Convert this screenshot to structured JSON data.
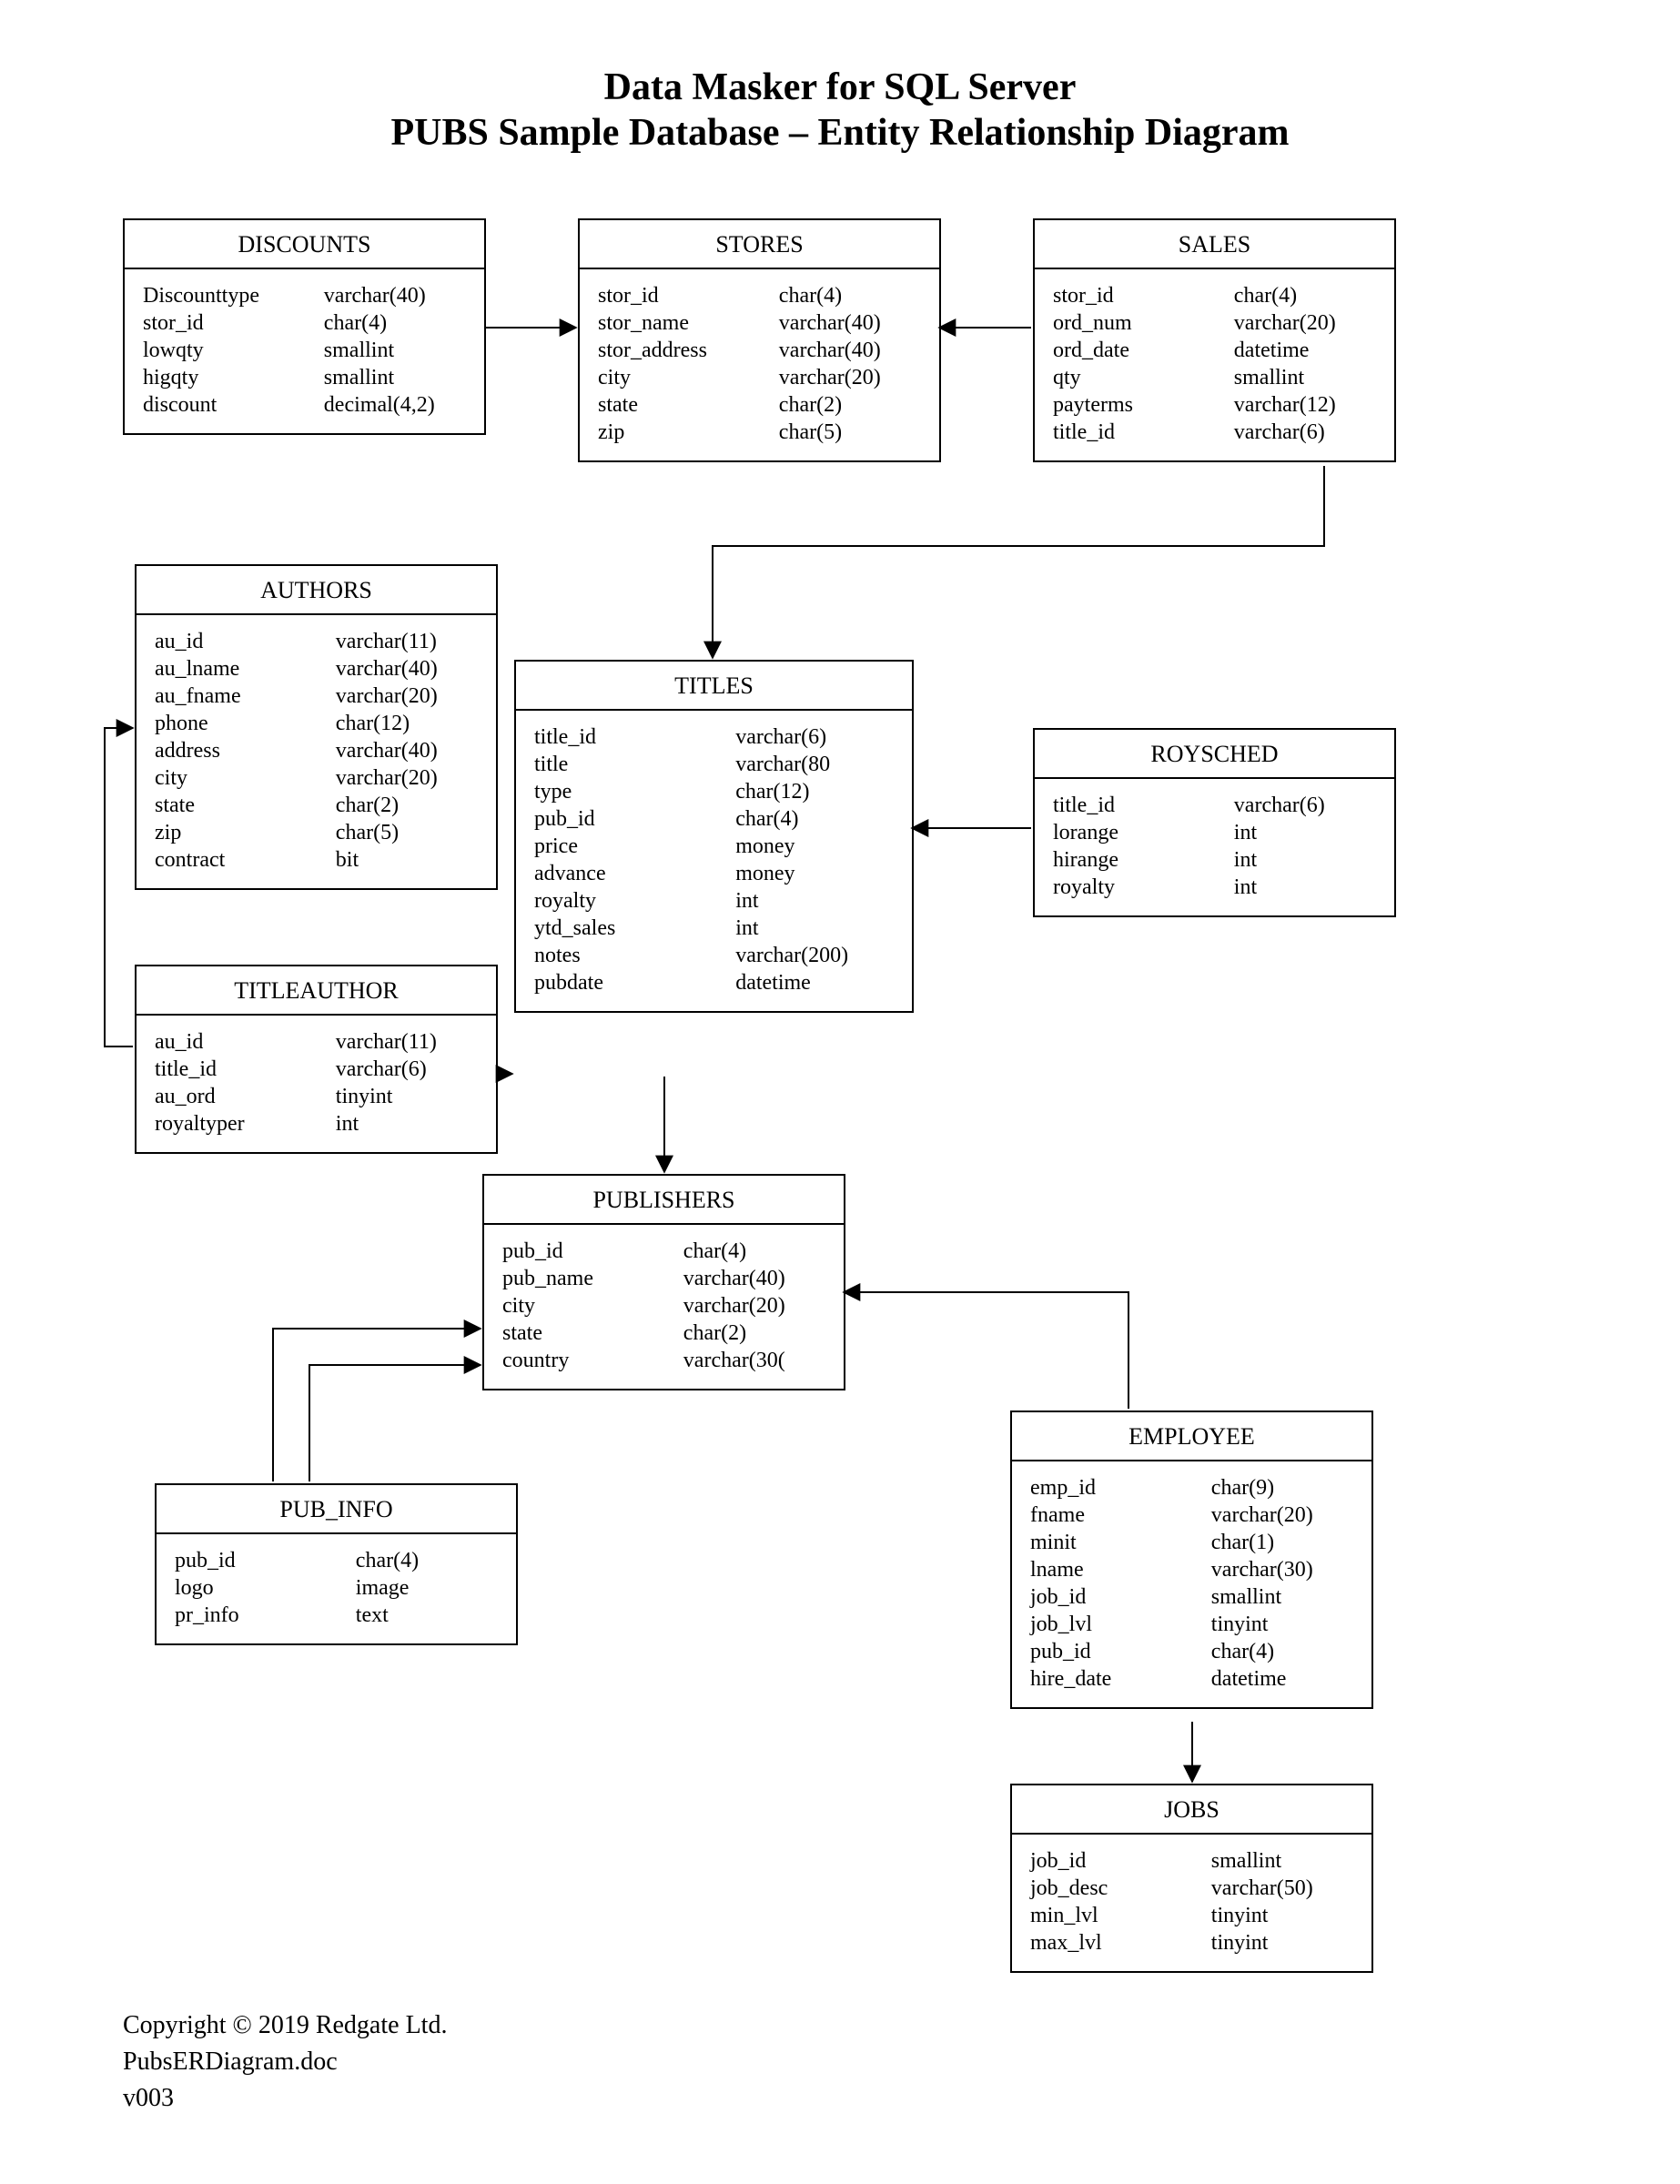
{
  "title_line1": "Data Masker for SQL Server",
  "title_line2": "PUBS Sample Database  – Entity Relationship Diagram",
  "footer": {
    "copyright": "Copyright © 2019 Redgate Ltd.",
    "filename": "PubsERDiagram.doc",
    "version": "v003"
  },
  "entities": {
    "discounts": {
      "name": "DISCOUNTS",
      "columns": [
        [
          "Discounttype",
          "varchar(40)"
        ],
        [
          "stor_id",
          "char(4)"
        ],
        [
          "lowqty",
          "smallint"
        ],
        [
          "higqty",
          "smallint"
        ],
        [
          "discount",
          "decimal(4,2)"
        ]
      ]
    },
    "stores": {
      "name": "STORES",
      "columns": [
        [
          "stor_id",
          "char(4)"
        ],
        [
          "stor_name",
          "varchar(40)"
        ],
        [
          "stor_address",
          "varchar(40)"
        ],
        [
          "city",
          "varchar(20)"
        ],
        [
          "state",
          "char(2)"
        ],
        [
          "zip",
          "char(5)"
        ]
      ]
    },
    "sales": {
      "name": "SALES",
      "columns": [
        [
          "stor_id",
          "char(4)"
        ],
        [
          "ord_num",
          "varchar(20)"
        ],
        [
          "ord_date",
          "datetime"
        ],
        [
          "qty",
          "smallint"
        ],
        [
          "payterms",
          "varchar(12)"
        ],
        [
          "title_id",
          "varchar(6)"
        ]
      ]
    },
    "authors": {
      "name": "AUTHORS",
      "columns": [
        [
          "au_id",
          "varchar(11)"
        ],
        [
          "au_lname",
          "varchar(40)"
        ],
        [
          "au_fname",
          "varchar(20)"
        ],
        [
          "phone",
          "char(12)"
        ],
        [
          "address",
          "varchar(40)"
        ],
        [
          "city",
          "varchar(20)"
        ],
        [
          "state",
          "char(2)"
        ],
        [
          "zip",
          "char(5)"
        ],
        [
          "contract",
          "bit"
        ]
      ]
    },
    "titles": {
      "name": "TITLES",
      "columns": [
        [
          "title_id",
          "varchar(6)"
        ],
        [
          "title",
          "varchar(80"
        ],
        [
          "type",
          "char(12)"
        ],
        [
          "pub_id",
          "char(4)"
        ],
        [
          "price",
          "money"
        ],
        [
          "advance",
          "money"
        ],
        [
          "royalty",
          "int"
        ],
        [
          "ytd_sales",
          "int"
        ],
        [
          "notes",
          "varchar(200)"
        ],
        [
          "pubdate",
          "datetime"
        ]
      ]
    },
    "roysched": {
      "name": "ROYSCHED",
      "columns": [
        [
          "title_id",
          "varchar(6)"
        ],
        [
          "lorange",
          "int"
        ],
        [
          "hirange",
          "int"
        ],
        [
          "royalty",
          "int"
        ]
      ]
    },
    "titleauthor": {
      "name": "TITLEAUTHOR",
      "columns": [
        [
          "au_id",
          "varchar(11)"
        ],
        [
          "title_id",
          "varchar(6)"
        ],
        [
          "au_ord",
          "tinyint"
        ],
        [
          "royaltyper",
          "int"
        ]
      ]
    },
    "publishers": {
      "name": "PUBLISHERS",
      "columns": [
        [
          "pub_id",
          "char(4)"
        ],
        [
          "pub_name",
          "varchar(40)"
        ],
        [
          "city",
          "varchar(20)"
        ],
        [
          "state",
          "char(2)"
        ],
        [
          "country",
          "varchar(30("
        ]
      ]
    },
    "employee": {
      "name": "EMPLOYEE",
      "columns": [
        [
          "emp_id",
          "char(9)"
        ],
        [
          "fname",
          "varchar(20)"
        ],
        [
          "minit",
          "char(1)"
        ],
        [
          "lname",
          "varchar(30)"
        ],
        [
          "job_id",
          "smallint"
        ],
        [
          "job_lvl",
          "tinyint"
        ],
        [
          "pub_id",
          "char(4)"
        ],
        [
          "hire_date",
          "datetime"
        ]
      ]
    },
    "pub_info": {
      "name": "PUB_INFO",
      "columns": [
        [
          "pub_id",
          "char(4)"
        ],
        [
          "logo",
          "image"
        ],
        [
          "pr_info",
          "text"
        ]
      ]
    },
    "jobs": {
      "name": "JOBS",
      "columns": [
        [
          "job_id",
          "smallint"
        ],
        [
          "job_desc",
          "varchar(50)"
        ],
        [
          "min_lvl",
          "tinyint"
        ],
        [
          "max_lvl",
          "tinyint"
        ]
      ]
    }
  },
  "relationships": [
    {
      "from": "discounts",
      "to": "stores"
    },
    {
      "from": "sales",
      "to": "stores"
    },
    {
      "from": "sales",
      "to": "titles"
    },
    {
      "from": "roysched",
      "to": "titles"
    },
    {
      "from": "titleauthor",
      "to": "authors"
    },
    {
      "from": "titleauthor",
      "to": "titles"
    },
    {
      "from": "titles",
      "to": "publishers"
    },
    {
      "from": "employee",
      "to": "publishers"
    },
    {
      "from": "employee",
      "to": "jobs"
    },
    {
      "from": "pub_info",
      "to": "publishers"
    }
  ]
}
